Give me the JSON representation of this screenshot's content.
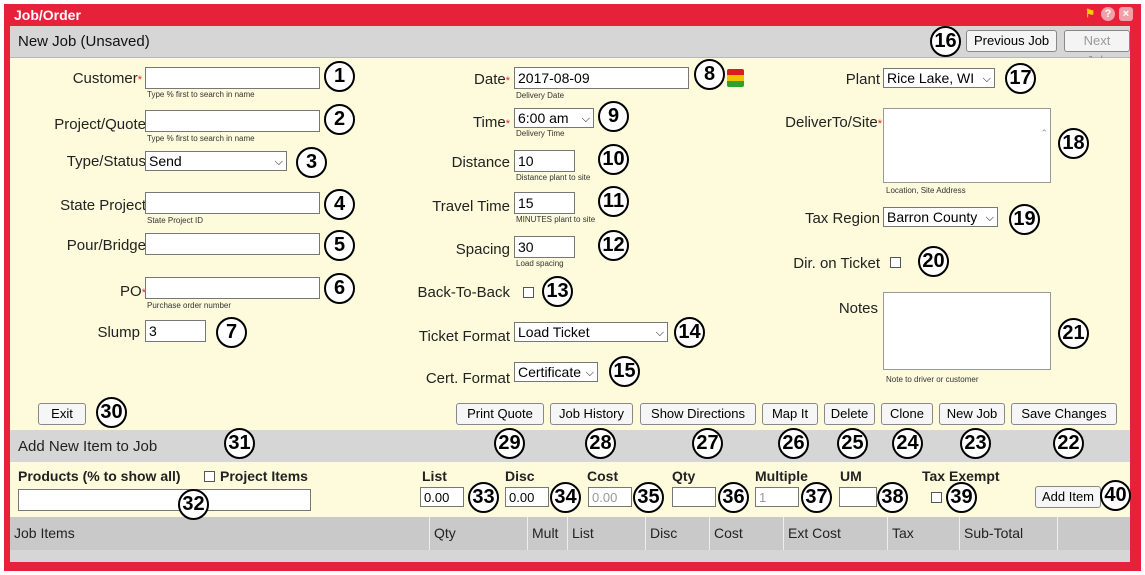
{
  "window": {
    "title": "Job/Order"
  },
  "header": {
    "title": "New Job (Unsaved)",
    "previous_label": "Previous Job",
    "next_label": "Next Job"
  },
  "col1": {
    "customer_label": "Customer",
    "customer_hint": "Type % first to search in name",
    "project_label": "Project/Quote",
    "project_hint": "Type % first to search in name",
    "type_label": "Type/Status",
    "type_value": "Send",
    "state_label": "State Project",
    "state_hint": "State Project ID",
    "pour_label": "Pour/Bridge",
    "po_label": "PO",
    "po_hint": "Purchase order number",
    "slump_label": "Slump",
    "slump_value": "3"
  },
  "col2": {
    "date_label": "Date",
    "date_value": "2017-08-09",
    "date_hint": "Delivery Date",
    "time_label": "Time",
    "time_value": "6:00 am",
    "time_hint": "Delivery Time",
    "distance_label": "Distance",
    "distance_value": "10",
    "distance_hint": "Distance plant to site",
    "travel_label": "Travel Time",
    "travel_value": "15",
    "travel_hint": "MINUTES plant to site",
    "spacing_label": "Spacing",
    "spacing_value": "30",
    "spacing_hint": "Load spacing",
    "b2b_label": "Back-To-Back",
    "ticket_label": "Ticket Format",
    "ticket_value": "Load Ticket",
    "cert_label": "Cert. Format",
    "cert_value": "Certificate"
  },
  "col3": {
    "plant_label": "Plant",
    "plant_value": "Rice Lake, WI",
    "deliver_label": "DeliverTo/Site",
    "deliver_hint": "Location, Site Address",
    "tax_label": "Tax Region",
    "tax_value": "Barron County",
    "dir_label": "Dir. on Ticket",
    "notes_label": "Notes",
    "notes_hint": "Note to driver or customer"
  },
  "actions": {
    "exit": "Exit",
    "print_quote": "Print Quote",
    "job_history": "Job History",
    "show_directions": "Show Directions",
    "map_it": "Map It",
    "delete": "Delete",
    "clone": "Clone",
    "new_job": "New Job",
    "save_changes": "Save Changes"
  },
  "add_item": {
    "title": "Add New Item to Job",
    "products_label": "Products (% to show all)",
    "project_items_label": "Project Items",
    "list_label": "List",
    "list_value": "0.00",
    "disc_label": "Disc",
    "disc_value": "0.00",
    "cost_label": "Cost",
    "cost_value": "0.00",
    "qty_label": "Qty",
    "multiple_label": "Multiple",
    "multiple_value": "1",
    "um_label": "UM",
    "tax_exempt_label": "Tax Exempt",
    "add_item_button": "Add Item"
  },
  "table": {
    "columns": [
      "Job Items",
      "Qty",
      "Mult",
      "List",
      "Disc",
      "Cost",
      "Ext Cost",
      "Tax",
      "Sub-Total"
    ]
  },
  "callouts": [
    "1",
    "2",
    "3",
    "4",
    "5",
    "6",
    "7",
    "8",
    "9",
    "10",
    "11",
    "12",
    "13",
    "14",
    "15",
    "16",
    "17",
    "18",
    "19",
    "20",
    "21",
    "22",
    "23",
    "24",
    "25",
    "26",
    "27",
    "28",
    "29",
    "30",
    "31",
    "32",
    "33",
    "34",
    "35",
    "36",
    "37",
    "38",
    "39",
    "40"
  ],
  "colors": {
    "frame": "#e8213a",
    "panel": "#fdfbdb",
    "bar": "#d6d6d6"
  }
}
